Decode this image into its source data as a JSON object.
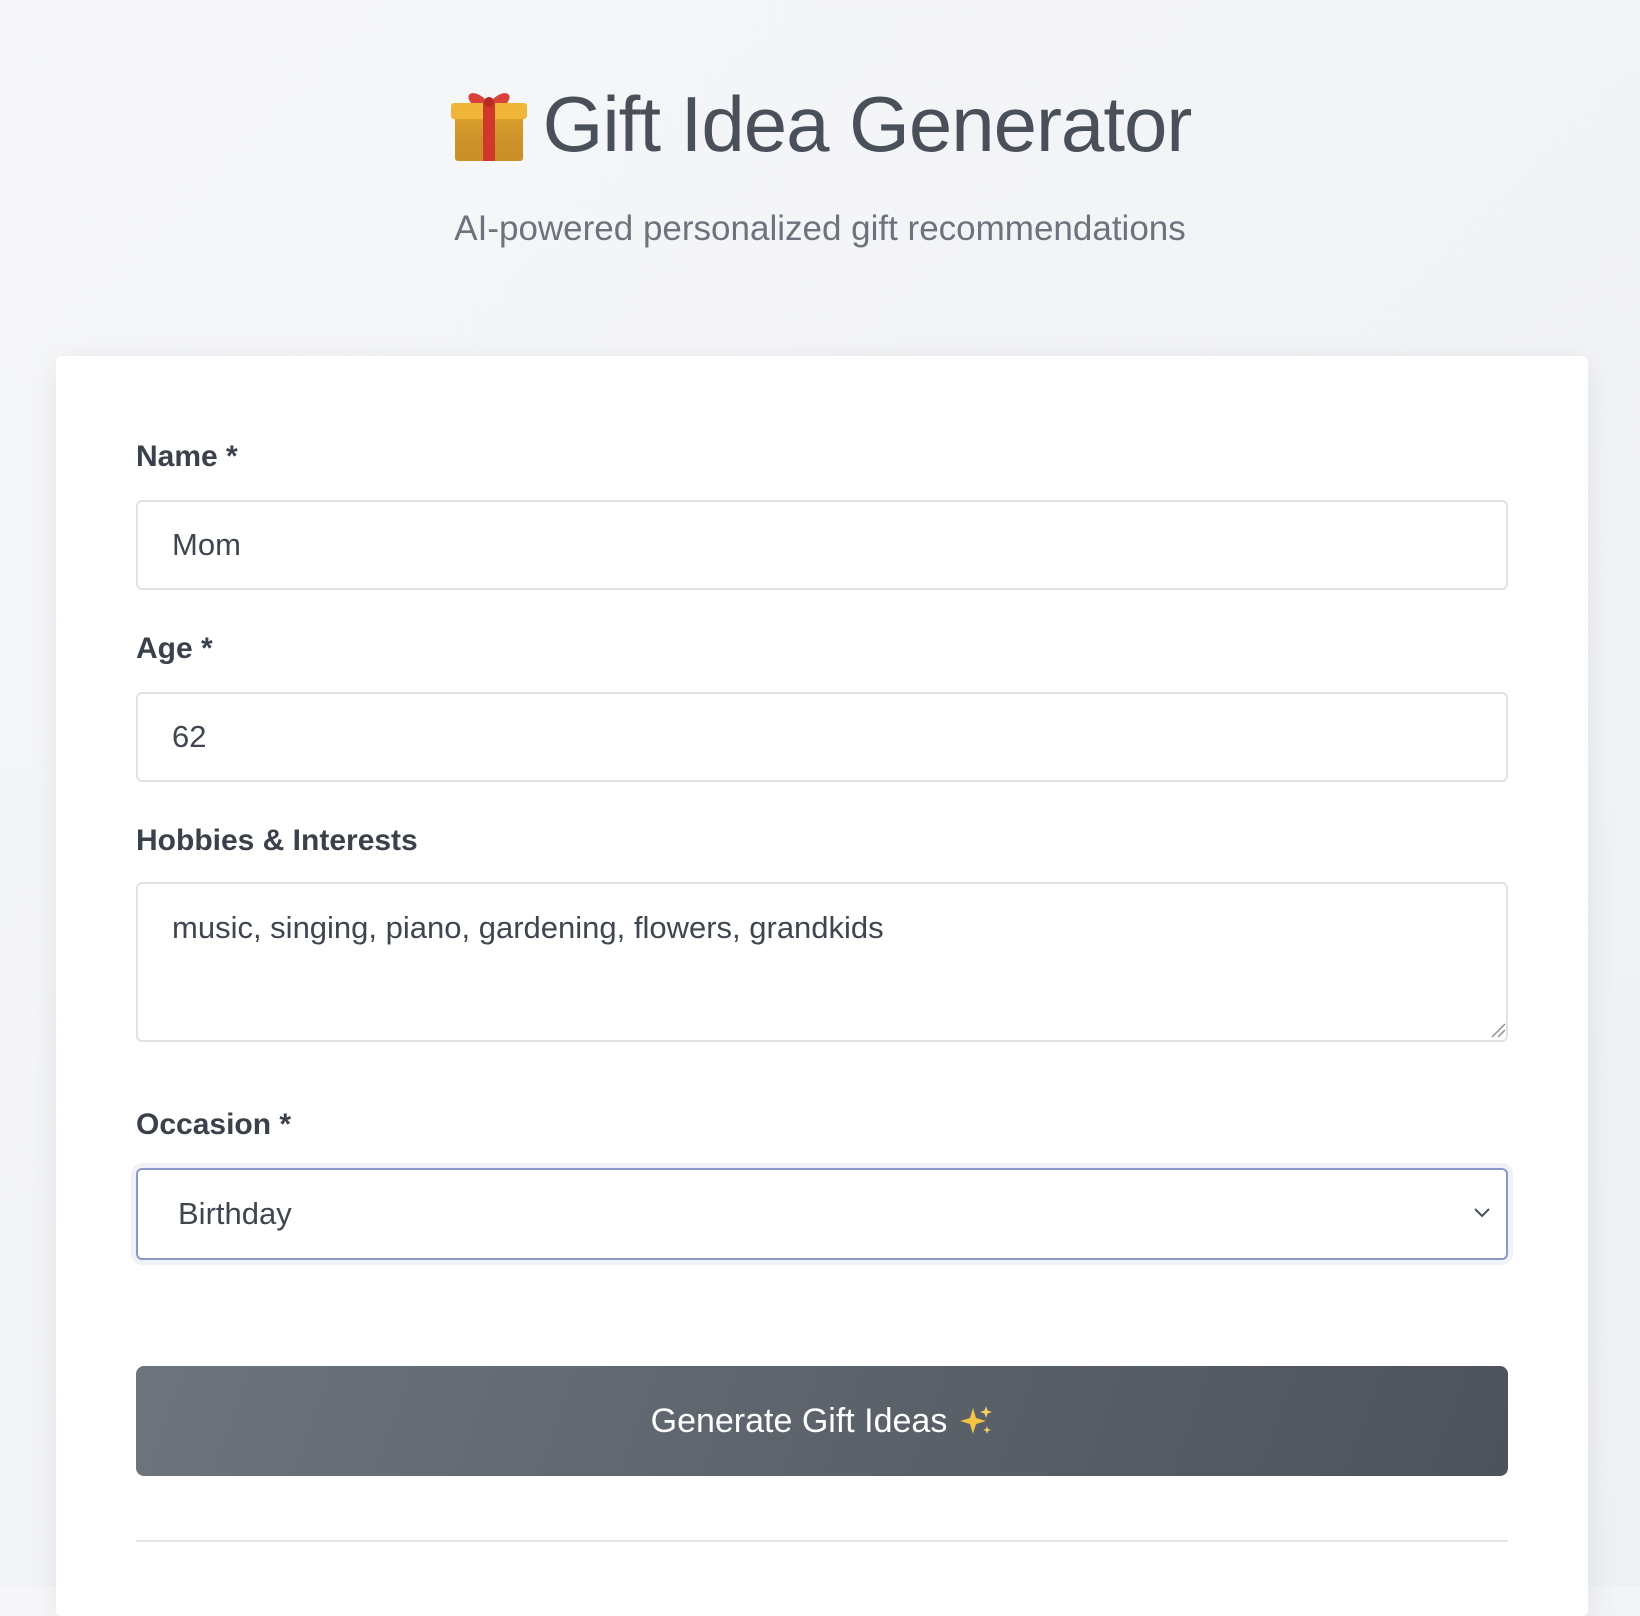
{
  "header": {
    "title": "Gift Idea Generator",
    "title_icon": "gift-icon",
    "subtitle": "AI-powered personalized gift recommendations"
  },
  "form": {
    "name": {
      "label": "Name *",
      "value": "Mom"
    },
    "age": {
      "label": "Age *",
      "value": "62"
    },
    "hobbies": {
      "label": "Hobbies & Interests",
      "value": "music, singing, piano, gardening, flowers, grandkids"
    },
    "occasion": {
      "label": "Occasion *",
      "selected": "Birthday"
    },
    "submit": {
      "label": "Generate Gift Ideas",
      "icon": "sparkles-icon"
    }
  },
  "colors": {
    "button_gradient_start": "#6d747c",
    "button_gradient_end": "#4d525b",
    "focus_border": "#8c98c8",
    "text": "#3f4650"
  }
}
